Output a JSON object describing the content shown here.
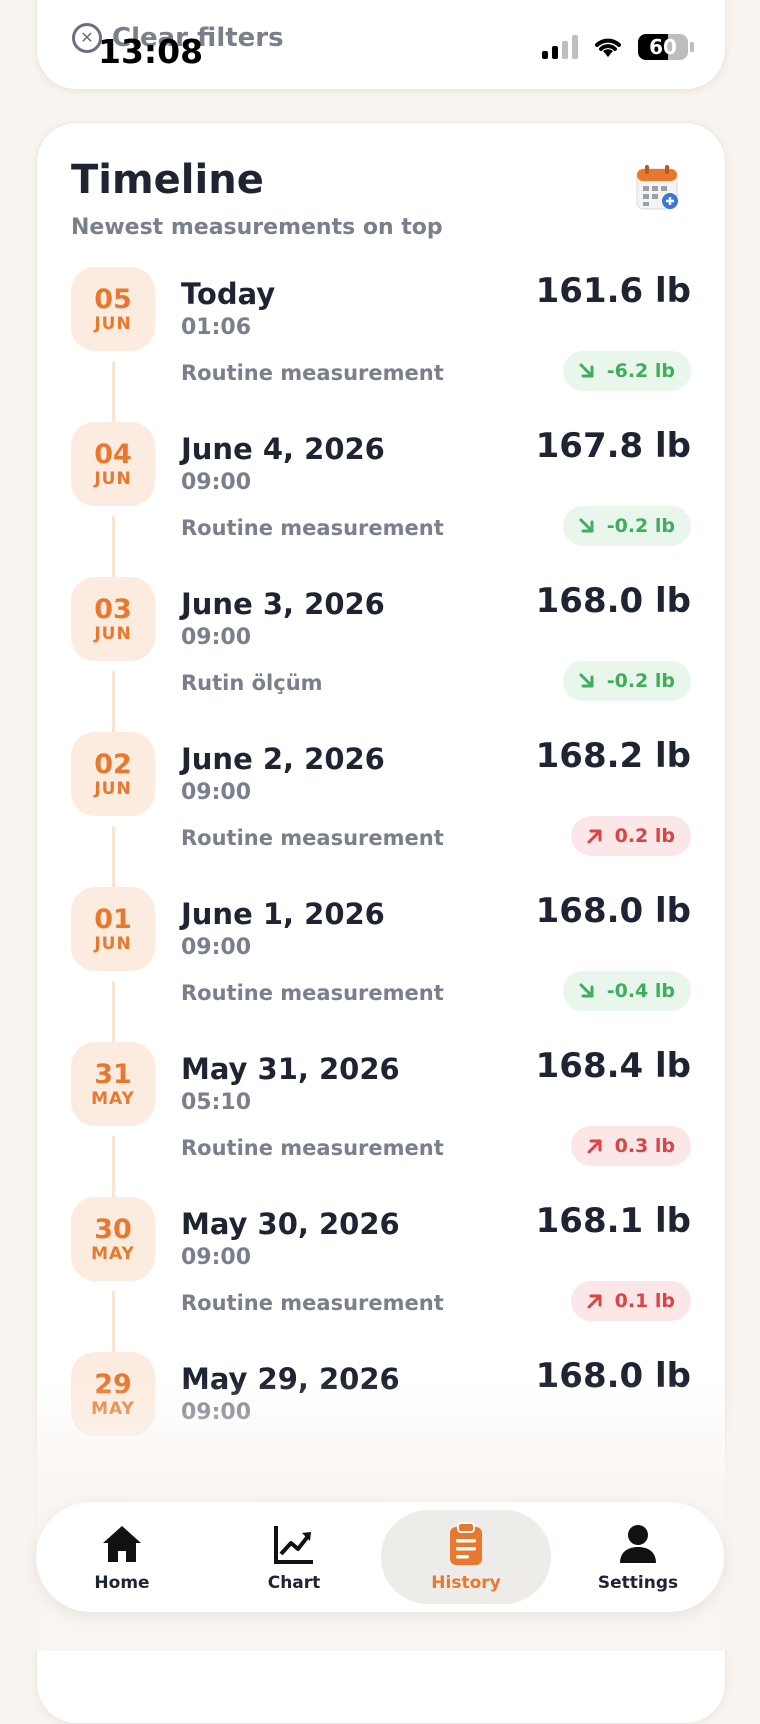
{
  "status_bar": {
    "time": "13:08",
    "battery": "60"
  },
  "filters": {
    "clear_label": "Clear filters"
  },
  "timeline": {
    "title": "Timeline",
    "subtitle": "Newest measurements on top",
    "entries": [
      {
        "day": "05",
        "month": "JUN",
        "date": "Today",
        "time": "01:06",
        "note": "Routine measurement",
        "weight": "161.6 lb",
        "delta": "-6.2 lb",
        "direction": "down"
      },
      {
        "day": "04",
        "month": "JUN",
        "date": "June 4, 2026",
        "time": "09:00",
        "note": "Routine measurement",
        "weight": "167.8 lb",
        "delta": "-0.2 lb",
        "direction": "down"
      },
      {
        "day": "03",
        "month": "JUN",
        "date": "June 3, 2026",
        "time": "09:00",
        "note": "Rutin ölçüm",
        "weight": "168.0 lb",
        "delta": "-0.2 lb",
        "direction": "down"
      },
      {
        "day": "02",
        "month": "JUN",
        "date": "June 2, 2026",
        "time": "09:00",
        "note": "Routine measurement",
        "weight": "168.2 lb",
        "delta": "0.2 lb",
        "direction": "up"
      },
      {
        "day": "01",
        "month": "JUN",
        "date": "June 1, 2026",
        "time": "09:00",
        "note": "Routine measurement",
        "weight": "168.0 lb",
        "delta": "-0.4 lb",
        "direction": "down"
      },
      {
        "day": "31",
        "month": "MAY",
        "date": "May 31, 2026",
        "time": "05:10",
        "note": "Routine measurement",
        "weight": "168.4 lb",
        "delta": "0.3 lb",
        "direction": "up"
      },
      {
        "day": "30",
        "month": "MAY",
        "date": "May 30, 2026",
        "time": "09:00",
        "note": "Routine measurement",
        "weight": "168.1 lb",
        "delta": "0.1 lb",
        "direction": "up"
      },
      {
        "day": "29",
        "month": "MAY",
        "date": "May 29, 2026",
        "time": "09:00",
        "note": "",
        "weight": "168.0 lb",
        "delta": "",
        "direction": ""
      }
    ]
  },
  "tabbar": {
    "tabs": [
      {
        "label": "Home",
        "icon": "home-icon"
      },
      {
        "label": "Chart",
        "icon": "chart-icon"
      },
      {
        "label": "History",
        "icon": "clipboard-icon",
        "active": true
      },
      {
        "label": "Settings",
        "icon": "person-icon"
      }
    ]
  },
  "colors": {
    "accent": "#e9782f",
    "down": "#3fae5c",
    "up": "#d94545"
  }
}
